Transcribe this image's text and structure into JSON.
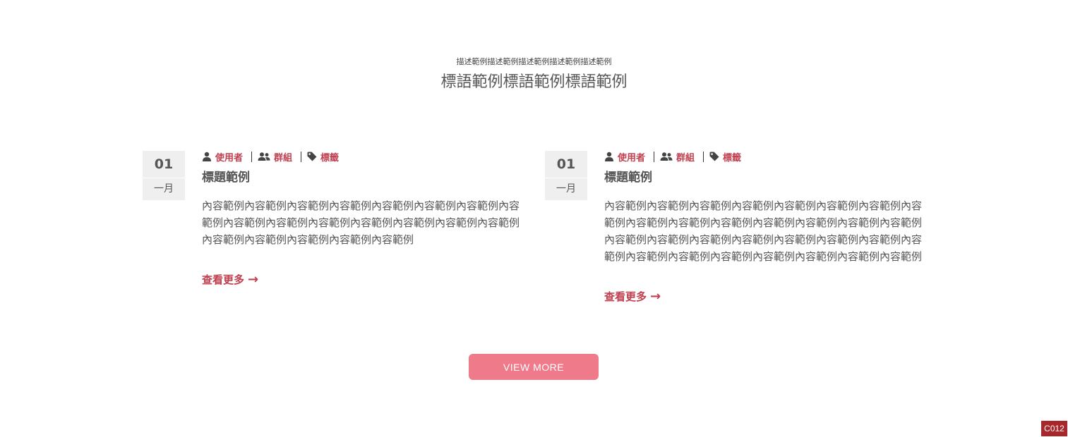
{
  "header": {
    "subtitle": "描述範例描述範例描述範例描述範例描述範例",
    "title": "標語範例標語範例標語範例"
  },
  "posts": [
    {
      "day": "01",
      "month": "一月",
      "meta": {
        "user": "使用者",
        "group": "群組",
        "tag": "標籤"
      },
      "title": "標題範例",
      "content": "內容範例內容範例內容範例內容範例內容範例內容範例內容範例內容範例內容範例內容範例內容範例內容範例內容範例內容範例內容範例內容範例內容範例內容範例內容範例內容範例",
      "read_more": "查看更多"
    },
    {
      "day": "01",
      "month": "一月",
      "meta": {
        "user": "使用者",
        "group": "群組",
        "tag": "標籤"
      },
      "title": "標題範例",
      "content": "內容範例內容範例內容範例內容範例內容範例內容範例內容範例內容範例內容範例內容範例內容範例內容範例內容範例內容範例內容範例內容範例內容範例內容範例內容範例內容範例內容範例內容範例內容範例內容範例內容範例內容範例內容範例內容範例內容範例內容範例",
      "read_more": "查看更多"
    }
  ],
  "view_more_label": "VIEW MORE",
  "code_badge": "C012",
  "icons": {
    "user": "user-icon",
    "group": "users-icon",
    "tag": "tag-icon",
    "arrow": "arrow-right-icon"
  },
  "colors": {
    "accent": "#c0404f",
    "button": "#ef7a8a",
    "date_box": "#efefef",
    "badge": "#a8272a"
  }
}
